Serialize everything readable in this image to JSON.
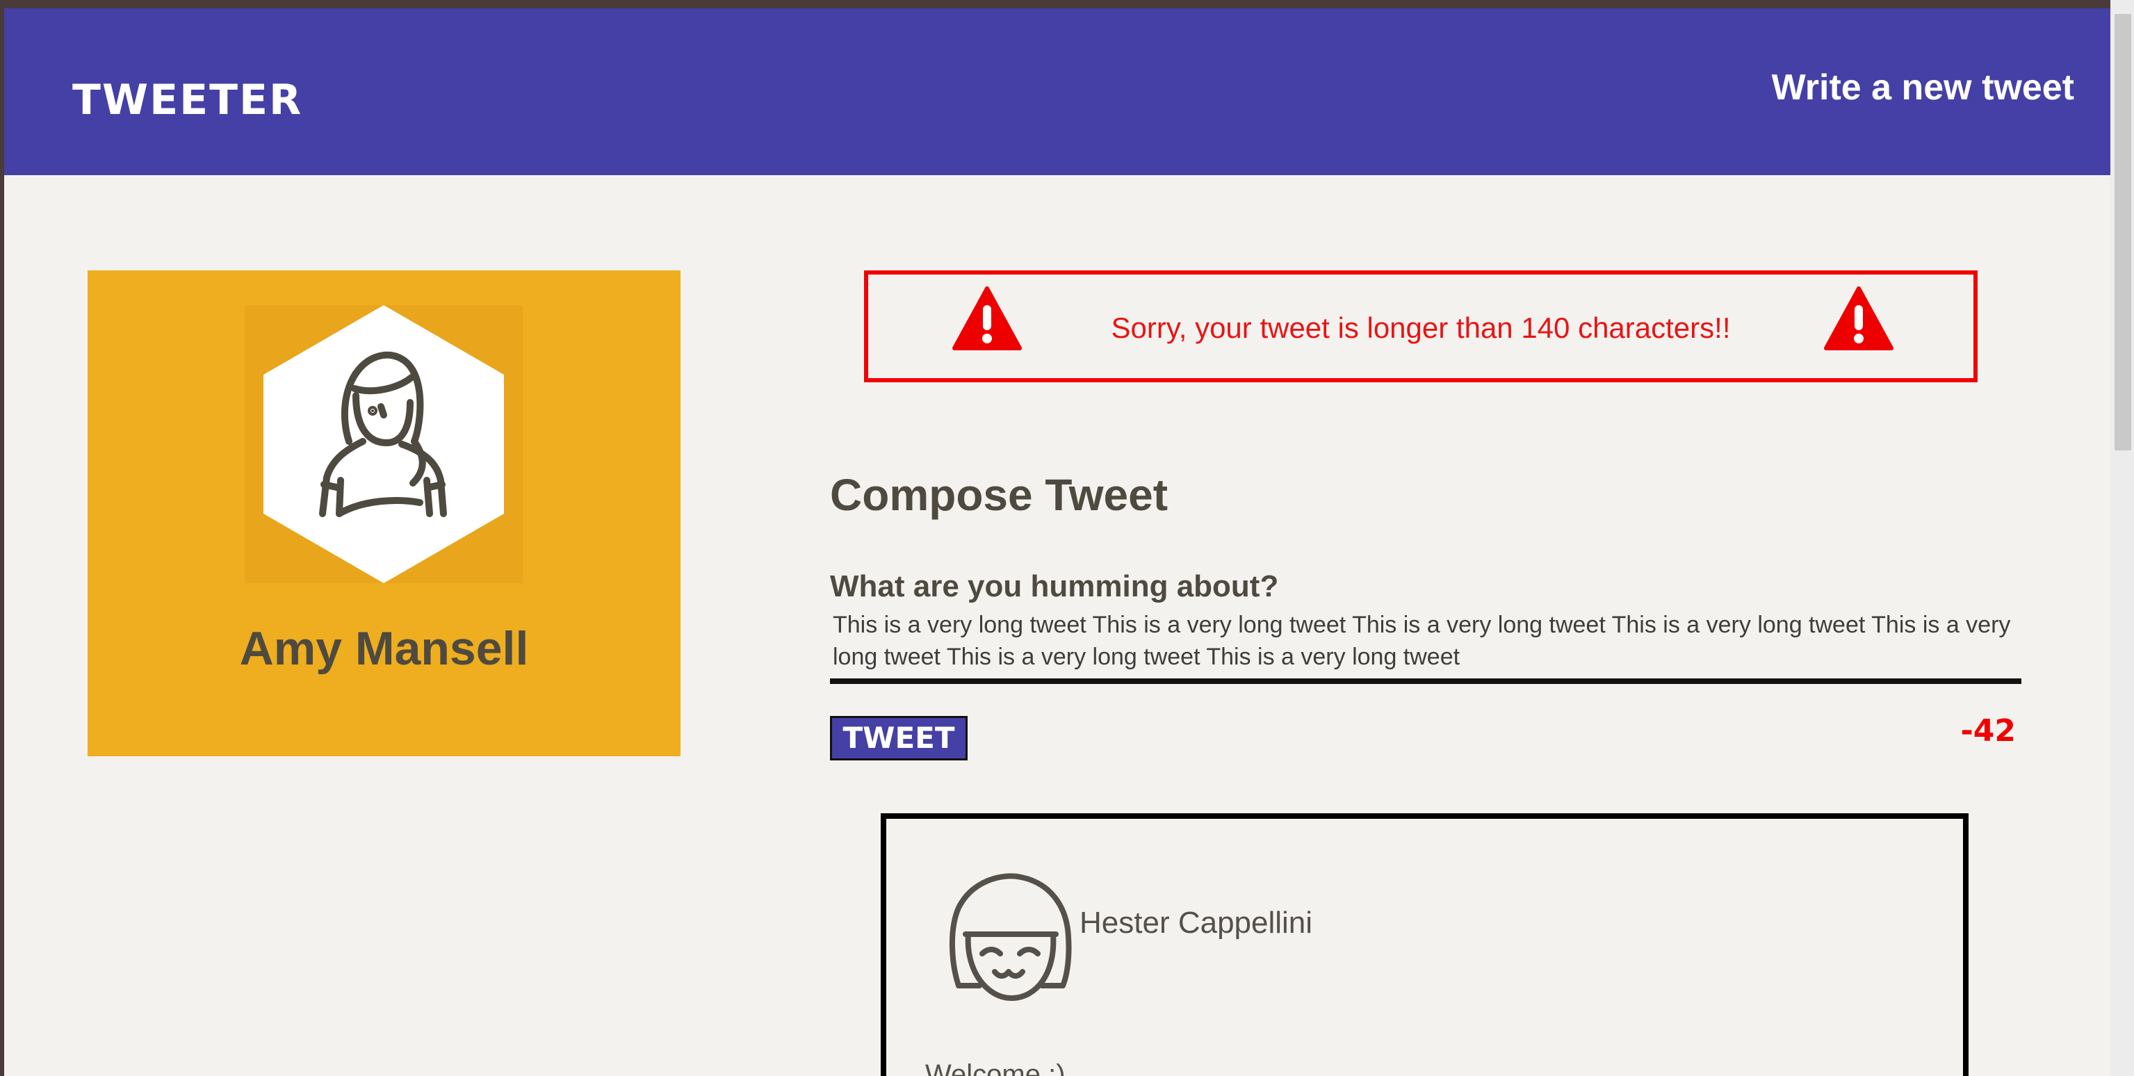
{
  "nav": {
    "brand": "TWEETER",
    "write_link": "Write a new tweet"
  },
  "profile": {
    "name": "Amy Mansell",
    "avatar_icon": "hexagon-girl-avatar-icon"
  },
  "error": {
    "message": "Sorry, your tweet is longer than 140 characters!!",
    "icon": "warning-icon",
    "color": "#f00000"
  },
  "compose": {
    "title": "Compose Tweet",
    "label": "What are you humming about?",
    "text_value": "This is a very long tweet This is a very long tweet This is a very long tweet This is a very long tweet This is a very long tweet This is a very long tweet This is a very long tweet",
    "button_label": "TWEET",
    "counter": "-42"
  },
  "tweets": [
    {
      "author": "Hester Cappellini",
      "avatar_icon": "girl-face-avatar-icon",
      "content": "Welcome :)"
    }
  ],
  "colors": {
    "nav": "#4540a6",
    "profile_card": "#eeae1f",
    "background": "#f4f2ef",
    "text": "#4f4a40"
  }
}
